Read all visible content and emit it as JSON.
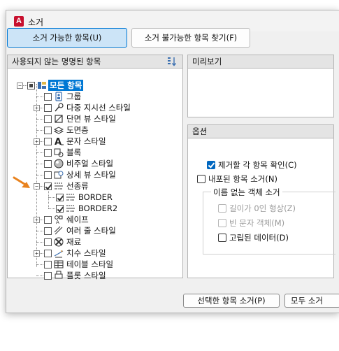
{
  "window": {
    "title": "소거",
    "app_icon": "autocad-a-icon"
  },
  "tabs": [
    {
      "label": "소거 가능한 항목(U)",
      "active": true
    },
    {
      "label": "소거 불가능한 항목 찾기(F)",
      "active": false
    }
  ],
  "tree_panel": {
    "header": "사용되지 않는 명명된 항목",
    "sort_icon": "sort-icon",
    "root": {
      "label": "모든 항목",
      "selected": true
    },
    "items": [
      {
        "label": "그룹",
        "icon": "group-icon",
        "expandable": false,
        "checked": false
      },
      {
        "label": "다중 지시선 스타일",
        "icon": "multileader-style-icon",
        "expandable": true,
        "checked": false
      },
      {
        "label": "단면 뷰 스타일",
        "icon": "section-view-style-icon",
        "expandable": false,
        "checked": false
      },
      {
        "label": "도면층",
        "icon": "layer-icon",
        "expandable": false,
        "checked": false
      },
      {
        "label": "문자 스타일",
        "icon": "text-style-icon",
        "expandable": true,
        "checked": false
      },
      {
        "label": "블록",
        "icon": "block-icon",
        "expandable": false,
        "checked": false
      },
      {
        "label": "비주얼 스타일",
        "icon": "visual-style-icon",
        "expandable": false,
        "checked": false
      },
      {
        "label": "상세 뷰 스타일",
        "icon": "detail-view-style-icon",
        "expandable": false,
        "checked": false
      },
      {
        "label": "선종류",
        "icon": "linetype-icon",
        "expandable": true,
        "expanded": true,
        "checked": true
      },
      {
        "label": "BORDER",
        "icon": "linetype-icon",
        "child": true,
        "checked": true
      },
      {
        "label": "BORDER2",
        "icon": "linetype-icon",
        "child": true,
        "checked": true
      },
      {
        "label": "쉐이프",
        "icon": "shape-icon",
        "expandable": true,
        "checked": false
      },
      {
        "label": "여러 줄 스타일",
        "icon": "multiline-style-icon",
        "expandable": false,
        "checked": false
      },
      {
        "label": "재료",
        "icon": "material-icon",
        "expandable": false,
        "checked": false
      },
      {
        "label": "치수 스타일",
        "icon": "dimension-style-icon",
        "expandable": true,
        "checked": false
      },
      {
        "label": "테이블 스타일",
        "icon": "table-style-icon",
        "expandable": false,
        "checked": false
      },
      {
        "label": "플롯 스타일",
        "icon": "plot-style-icon",
        "expandable": false,
        "checked": false
      }
    ]
  },
  "preview": {
    "header": "미리보기"
  },
  "options": {
    "header": "옵션",
    "confirm_each": {
      "label": "제거할 각 항목 확인(C)",
      "checked": true
    },
    "purge_nested": {
      "label": "내포된 항목 소거(N)",
      "checked": false
    },
    "unnamed_group": "이름 없는 객체 소거",
    "zero_length": {
      "label": "길이가 0인 형상(Z)",
      "checked": false,
      "enabled": false
    },
    "empty_text": {
      "label": "빈 문자 객체(M)",
      "checked": false,
      "enabled": false
    },
    "orphaned_data": {
      "label": "고립된 데이터(D)",
      "checked": false,
      "enabled": true
    }
  },
  "buttons": {
    "purge_selected": "선택한 항목 소거(P)",
    "purge_all": "모두 소거"
  },
  "colors": {
    "accent": "#0078d4",
    "arrow": "#e8821e"
  }
}
